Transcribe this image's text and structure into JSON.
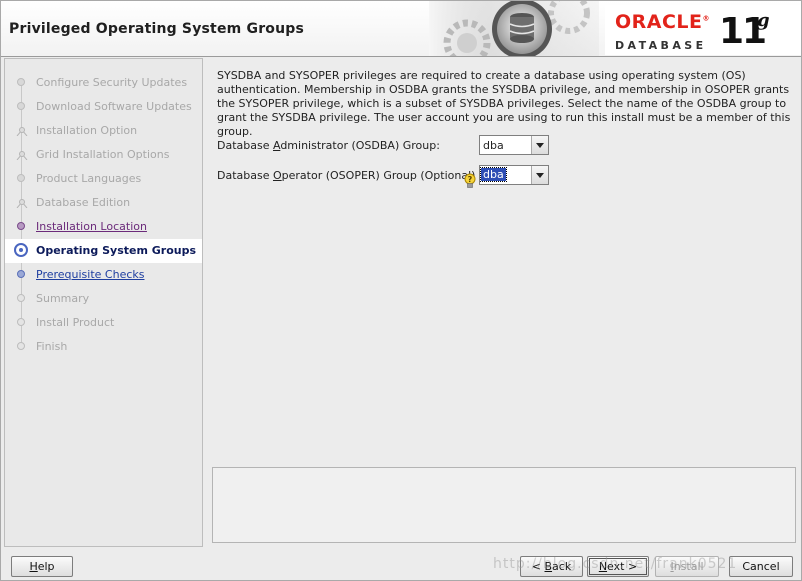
{
  "header": {
    "title": "Privileged Operating System Groups",
    "brand": {
      "oracle": "ORACLE",
      "trademark": "®",
      "database": "DATABASE",
      "version_number": "11",
      "version_letter": "g"
    }
  },
  "nav": {
    "steps": [
      {
        "label": "Configure Security Updates",
        "state": "done"
      },
      {
        "label": "Download Software Updates",
        "state": "done"
      },
      {
        "label": "Installation Option",
        "state": "done"
      },
      {
        "label": "Grid Installation Options",
        "state": "done"
      },
      {
        "label": "Product Languages",
        "state": "done"
      },
      {
        "label": "Database Edition",
        "state": "done"
      },
      {
        "label": "Installation Location",
        "state": "visited"
      },
      {
        "label": "Operating System Groups",
        "state": "current"
      },
      {
        "label": "Prerequisite Checks",
        "state": "link"
      },
      {
        "label": "Summary",
        "state": "pending"
      },
      {
        "label": "Install Product",
        "state": "pending"
      },
      {
        "label": "Finish",
        "state": "pending"
      }
    ]
  },
  "main": {
    "description": "SYSDBA and SYSOPER privileges are required to create a database using operating system (OS) authentication. Membership in OSDBA grants the SYSDBA privilege, and membership in OSOPER grants the SYSOPER privilege, which is a subset of SYSDBA privileges. Select the name of the OSDBA group to grant the SYSDBA privilege. The user account you are using to run this install must be a member of this group.",
    "osdba": {
      "label_pre": "Database ",
      "label_mnemonic": "A",
      "label_post": "dministrator (OSDBA) Group:",
      "value": "dba"
    },
    "osoper": {
      "label_pre": "Database ",
      "label_mnemonic": "O",
      "label_post": "perator (OSOPER) Group (Optional)",
      "value": "dba"
    }
  },
  "footer": {
    "help": {
      "mnemonic": "H",
      "rest": "elp"
    },
    "back": {
      "pre": "< ",
      "mnemonic": "B",
      "rest": "ack"
    },
    "next": {
      "mnemonic": "N",
      "rest": "ext >"
    },
    "install": {
      "mnemonic": "I",
      "rest": "nstall"
    },
    "cancel": {
      "mnemonic": "",
      "label": "Cancel"
    },
    "watermark": "http://blog.csdn.net/frank0521"
  },
  "colors": {
    "accent": "#2f4fb5",
    "oracle_red": "#e2231a",
    "link": "#1e3ea0",
    "visited": "#6b2a7a"
  },
  "icons": {
    "hint": "lightbulb-hint-icon",
    "header_art": "database-cylinder-gears-icon"
  }
}
